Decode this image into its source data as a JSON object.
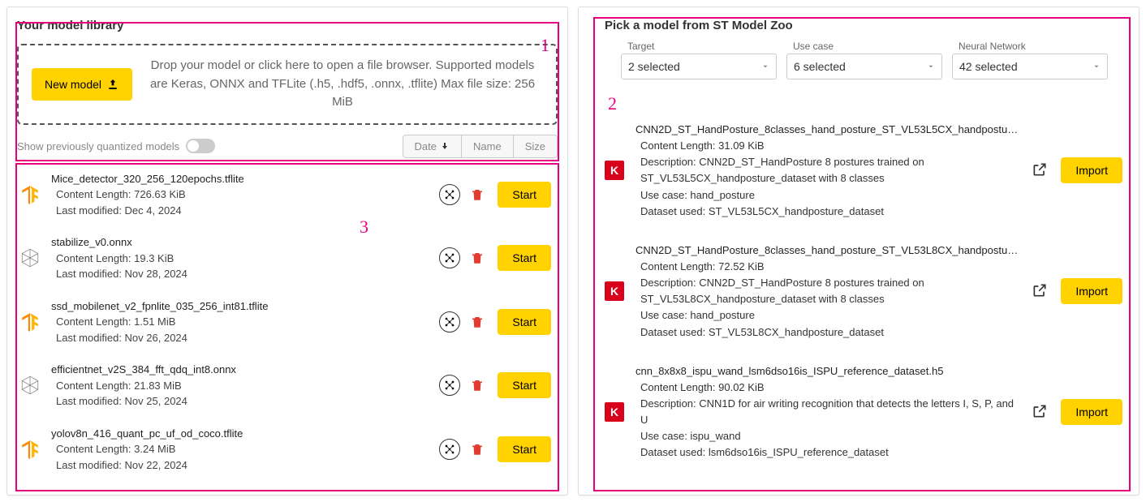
{
  "left": {
    "title": "Your model library",
    "new_model_label": "New model",
    "drop_text": "Drop your model or click here to open a file browser. Supported models are Keras, ONNX and TFLite (.h5, .hdf5, .onnx, .tflite) Max file size: 256 MiB",
    "toggle_label": "Show previously quantized models",
    "sort": {
      "date": "Date",
      "name": "Name",
      "size": "Size"
    },
    "start_label": "Start",
    "models": [
      {
        "type": "tf",
        "name": "Mice_detector_320_256_120epochs.tflite",
        "len": "Content Length: 726.63 KiB",
        "mod": "Last modified: Dec 4, 2024"
      },
      {
        "type": "onnx",
        "name": "stabilize_v0.onnx",
        "len": "Content Length: 19.3 KiB",
        "mod": "Last modified: Nov 28, 2024"
      },
      {
        "type": "tf",
        "name": "ssd_mobilenet_v2_fpnlite_035_256_int81.tflite",
        "len": "Content Length: 1.51 MiB",
        "mod": "Last modified: Nov 26, 2024"
      },
      {
        "type": "onnx",
        "name": "efficientnet_v2S_384_fft_qdq_int8.onnx",
        "len": "Content Length: 21.83 MiB",
        "mod": "Last modified: Nov 25, 2024"
      },
      {
        "type": "tf",
        "name": "yolov8n_416_quant_pc_uf_od_coco.tflite",
        "len": "Content Length: 3.24 MiB",
        "mod": "Last modified: Nov 22, 2024"
      }
    ]
  },
  "right": {
    "title": "Pick a model from ST Model Zoo",
    "import_label": "Import",
    "filters": [
      {
        "label": "Target",
        "value": "2 selected"
      },
      {
        "label": "Use case",
        "value": "6 selected"
      },
      {
        "label": "Neural Network",
        "value": "42 selected"
      }
    ],
    "models": [
      {
        "name": "CNN2D_ST_HandPosture_8classes_hand_posture_ST_VL53L5CX_handpostur…",
        "len": "Content Length: 31.09 KiB",
        "desc": "Description: CNN2D_ST_HandPosture 8 postures trained on ST_VL53L5CX_handposture_dataset with 8 classes",
        "use": "Use case: hand_posture",
        "ds": "Dataset used: ST_VL53L5CX_handposture_dataset"
      },
      {
        "name": "CNN2D_ST_HandPosture_8classes_hand_posture_ST_VL53L8CX_handpostur…",
        "len": "Content Length: 72.52 KiB",
        "desc": "Description: CNN2D_ST_HandPosture 8 postures trained on ST_VL53L8CX_handposture_dataset with 8 classes",
        "use": "Use case: hand_posture",
        "ds": "Dataset used: ST_VL53L8CX_handposture_dataset"
      },
      {
        "name": "cnn_8x8x8_ispu_wand_lsm6dso16is_ISPU_reference_dataset.h5",
        "len": "Content Length: 90.02 KiB",
        "desc": "Description: CNN1D for air writing recognition that detects the letters I, S, P, and U",
        "use": "Use case: ispu_wand",
        "ds": "Dataset used: lsm6dso16is_ISPU_reference_dataset"
      }
    ]
  },
  "annotations": {
    "1": "1",
    "2": "2",
    "3": "3"
  }
}
